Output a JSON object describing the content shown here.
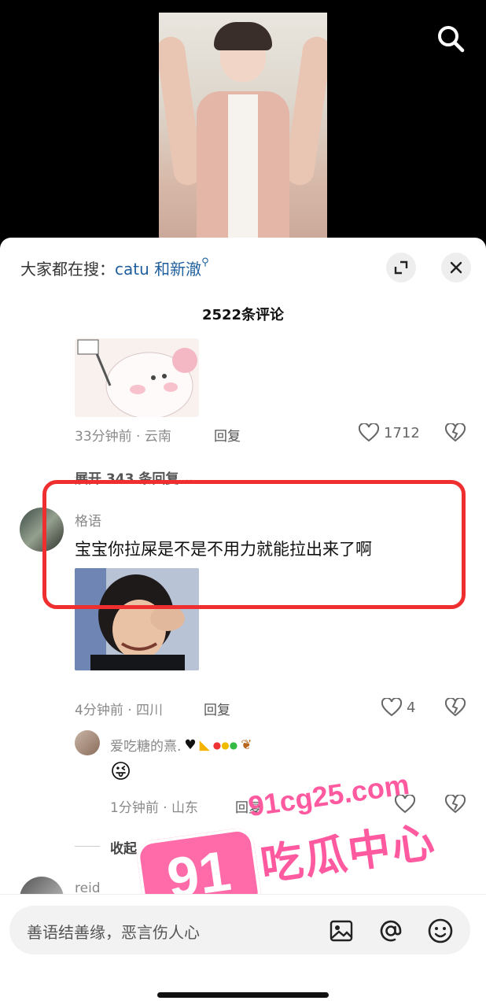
{
  "sheet": {
    "search_prefix": "大家都在搜：",
    "search_keyword": "catu 和新澈",
    "comment_count": "2522条评论"
  },
  "comment1": {
    "meta": "33分钟前 · 云南",
    "reply": "回复",
    "likes": "1712",
    "expand": "展开 343 条回复"
  },
  "comment2": {
    "username": "格语",
    "text": "宝宝你拉屎是不是不用力就能拉出来了啊",
    "meta": "4分钟前 · 四川",
    "reply": "回复",
    "likes": "4"
  },
  "reply1": {
    "username": "爱吃糖的熹.",
    "text": "😜",
    "meta": "1分钟前 · 山东",
    "reply": "回复"
  },
  "collapse": "收起",
  "comment3": {
    "username": "reid"
  },
  "input": {
    "placeholder": "善语结善缘，恶言伤人心"
  },
  "watermark": {
    "badge": "91",
    "domain": "91cg25.com",
    "name": "吃瓜中心"
  },
  "colors": {
    "accent_red": "#ef2f2f",
    "keyword_blue": "#1f5f9e",
    "watermark_pink": "#ff5aa0"
  }
}
